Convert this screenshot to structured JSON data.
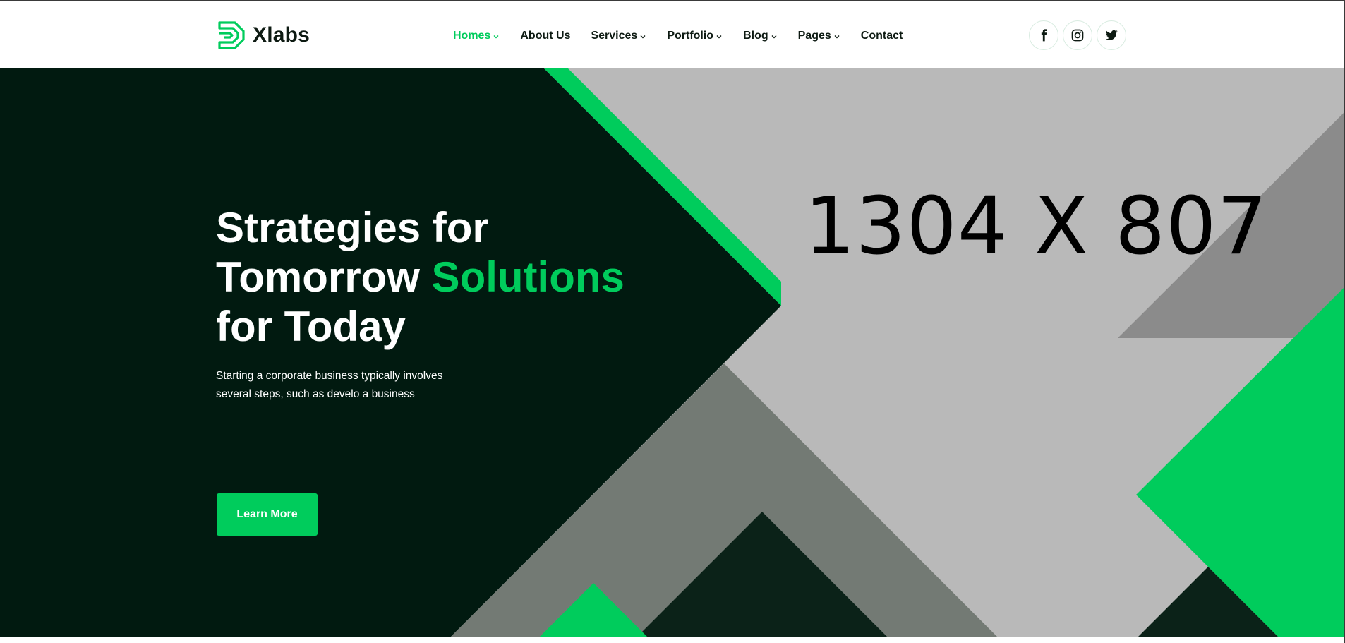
{
  "brand": {
    "name": "Xlabs",
    "icon": "xlabs-logo-mark",
    "accent_color": "#00cc5c",
    "dark_color": "#011a10"
  },
  "nav": {
    "items": [
      {
        "label": "Homes",
        "has_dropdown": true,
        "active": true
      },
      {
        "label": "About Us",
        "has_dropdown": false,
        "active": false
      },
      {
        "label": "Services",
        "has_dropdown": true,
        "active": false
      },
      {
        "label": "Portfolio",
        "has_dropdown": true,
        "active": false
      },
      {
        "label": "Blog",
        "has_dropdown": true,
        "active": false
      },
      {
        "label": "Pages",
        "has_dropdown": true,
        "active": false
      },
      {
        "label": "Contact",
        "has_dropdown": false,
        "active": false
      }
    ]
  },
  "socials": [
    {
      "icon": "facebook-icon"
    },
    {
      "icon": "instagram-icon"
    },
    {
      "icon": "twitter-icon"
    }
  ],
  "hero": {
    "title_line1": "Strategies for",
    "title_line2_start": "Tomorrow ",
    "title_line2_accent": "Solutions",
    "title_line3": "for Today",
    "description": "Starting a corporate business typically involves several steps, such as develo a business",
    "cta_label": "Learn More",
    "image_placeholder_text": "1304 X 807"
  }
}
